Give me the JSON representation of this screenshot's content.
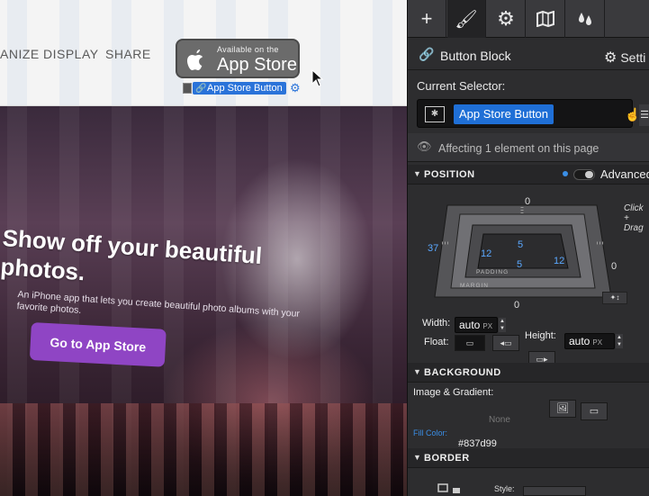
{
  "website": {
    "nav": [
      "ANIZE",
      "DISPLAY",
      "SHARE"
    ],
    "badge": {
      "small_text": "Available on the",
      "big_text": "App Store"
    },
    "selector_tag": "App Store Button",
    "hero": {
      "heading": "Show off your beautiful photos.",
      "subtext": "An iPhone app that lets you create beautiful photo albums with your favorite photos.",
      "cta": "Go to App Store"
    }
  },
  "panel": {
    "toolbar": [
      {
        "icon": "plus-icon",
        "glyph": "+"
      },
      {
        "icon": "brush-icon",
        "glyph": "🖌"
      },
      {
        "icon": "gear-icon",
        "glyph": "⚙"
      },
      {
        "icon": "map-icon",
        "glyph": "▯"
      },
      {
        "icon": "drops-icon",
        "glyph": "💧"
      },
      {
        "icon": "extra-icon",
        "glyph": ""
      }
    ],
    "block": {
      "title": "Button Block",
      "settings": "Setti"
    },
    "selector": {
      "label": "Current Selector:",
      "chip": "App Store Button"
    },
    "affecting": "Affecting 1 element on this page",
    "position": {
      "heading": "POSITION",
      "advanced": "Advanced",
      "box": {
        "margin_top": "0",
        "margin_right": "0",
        "margin_bottom": "0",
        "margin_left": "37",
        "padding_top": "5",
        "padding_right": "12",
        "padding_bottom": "5",
        "padding_left": "12",
        "padding_tag": "PADDING",
        "margin_tag": "MARGIN"
      },
      "drag_note": "Click + Drag",
      "width_label": "Width:",
      "width_value": "auto",
      "width_unit": "PX",
      "height_label": "Height:",
      "height_value": "auto",
      "height_unit": "PX",
      "float_label": "Float:"
    },
    "background": {
      "heading": "BACKGROUND",
      "image_gradient": "Image & Gradient:",
      "none": "None",
      "fill_label": "Fill Color:",
      "fill_value": "#837d99",
      "fill_color": "#837d99"
    },
    "border": {
      "heading": "BORDER",
      "style_label": "Style:"
    }
  },
  "colors": {
    "accent": "#1f6fd6",
    "cta": "#8f45c4",
    "panel": "#2d2d2f"
  }
}
